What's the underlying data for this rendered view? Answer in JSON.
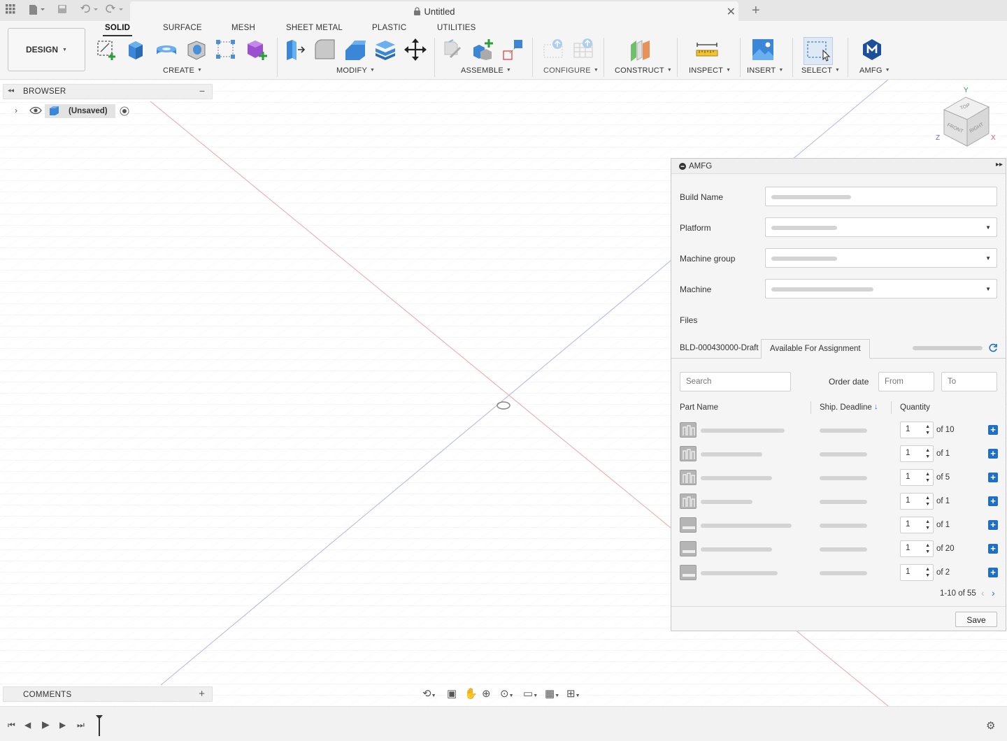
{
  "document": {
    "title": "Untitled"
  },
  "workspace": {
    "label": "DESIGN"
  },
  "tabs": [
    "SOLID",
    "SURFACE",
    "MESH",
    "SHEET METAL",
    "PLASTIC",
    "UTILITIES"
  ],
  "groups": [
    "CREATE",
    "MODIFY",
    "ASSEMBLE",
    "CONFIGURE",
    "CONSTRUCT",
    "INSPECT",
    "INSERT",
    "SELECT",
    "AMFG"
  ],
  "browser": {
    "title": "BROWSER",
    "root": "(Unsaved)"
  },
  "comments": {
    "title": "COMMENTS"
  },
  "viewcube": {
    "top": "TOP",
    "front": "FRONT",
    "right": "RIGHT",
    "x": "X",
    "y": "Y",
    "z": "Z"
  },
  "amfg": {
    "title": "AMFG",
    "build_name_label": "Build Name",
    "platform_label": "Platform",
    "machine_group_label": "Machine group",
    "machine_label": "Machine",
    "files_label": "Files",
    "file_tabs": [
      "BLD-000430000-Draft",
      "Available For Assignment"
    ],
    "search_placeholder": "Search",
    "order_date_label": "Order date",
    "from_placeholder": "From",
    "to_placeholder": "To",
    "columns": {
      "part_name": "Part Name",
      "ship_deadline": "Ship. Deadline",
      "quantity": "Quantity"
    },
    "rows": [
      {
        "qty": "1",
        "of": "of 10"
      },
      {
        "qty": "1",
        "of": "of 1"
      },
      {
        "qty": "1",
        "of": "of 5"
      },
      {
        "qty": "1",
        "of": "of 1"
      },
      {
        "qty": "1",
        "of": "of 1"
      },
      {
        "qty": "1",
        "of": "of 20"
      },
      {
        "qty": "1",
        "of": "of 2"
      }
    ],
    "pagination": "1-10 of 55",
    "save_label": "Save"
  },
  "colors": {
    "accent": "#1d6fc9",
    "x_axis": "#e55a5a",
    "y_axis": "#6b6bdc"
  }
}
